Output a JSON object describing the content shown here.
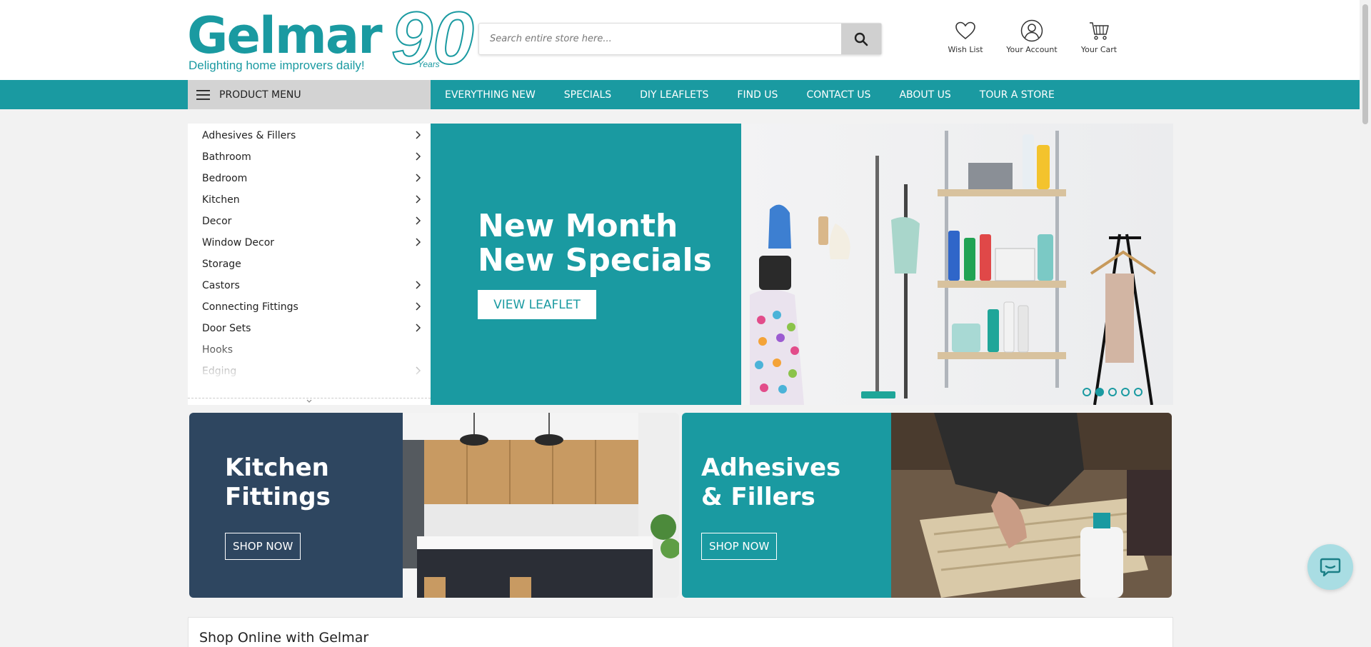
{
  "brand": {
    "name": "Gelmar",
    "tagline": "Delighting home improvers daily!",
    "anniversary_number": "90",
    "anniversary_word": "Years",
    "accent_color": "#1a9aa1",
    "navy_color": "#2e4660"
  },
  "search": {
    "placeholder": "Search entire store here...",
    "button_icon": "search-icon"
  },
  "header_links": [
    {
      "label": "Wish List",
      "icon": "heart-icon"
    },
    {
      "label": "Your Account",
      "icon": "user-icon"
    },
    {
      "label": "Your Cart",
      "icon": "cart-icon"
    }
  ],
  "nav": {
    "product_menu_label": "PRODUCT MENU",
    "links": [
      "EVERYTHING NEW",
      "SPECIALS",
      "DIY LEAFLETS",
      "FIND US",
      "CONTACT US",
      "ABOUT US",
      "TOUR A STORE"
    ]
  },
  "categories": [
    {
      "label": "Adhesives & Fillers",
      "has_sub": true
    },
    {
      "label": "Bathroom",
      "has_sub": true
    },
    {
      "label": "Bedroom",
      "has_sub": true
    },
    {
      "label": "Kitchen",
      "has_sub": true
    },
    {
      "label": "Decor",
      "has_sub": true
    },
    {
      "label": "Window Decor",
      "has_sub": true
    },
    {
      "label": "Storage",
      "has_sub": false
    },
    {
      "label": "Castors",
      "has_sub": true
    },
    {
      "label": "Connecting Fittings",
      "has_sub": true
    },
    {
      "label": "Door Sets",
      "has_sub": true
    },
    {
      "label": "Hooks",
      "has_sub": false
    },
    {
      "label": "Edging",
      "has_sub": true
    }
  ],
  "hero": {
    "title_line1": "New Month",
    "title_line2": "New Specials",
    "button_label": "VIEW LEAFLET",
    "slide_count": 5,
    "active_slide": 2
  },
  "promos": [
    {
      "title_line1": "Kitchen",
      "title_line2": "Fittings",
      "button_label": "SHOP NOW"
    },
    {
      "title_line1": "Adhesives",
      "title_line2": "& Fillers",
      "button_label": "SHOP NOW"
    }
  ],
  "shop_online": {
    "heading": "Shop Online with Gelmar"
  }
}
